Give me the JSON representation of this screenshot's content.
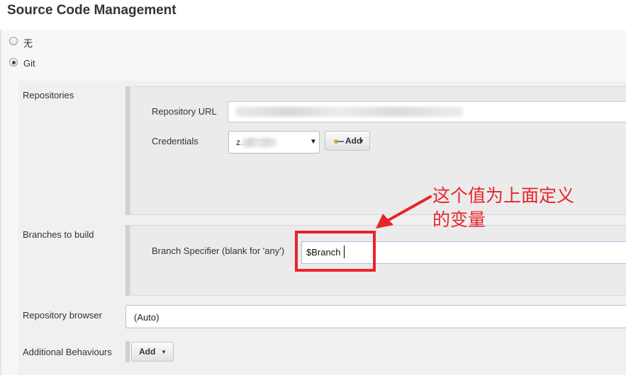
{
  "section": {
    "title": "Source Code Management"
  },
  "scm_options": [
    {
      "label": "无",
      "selected": false
    },
    {
      "label": "Git",
      "selected": true
    }
  ],
  "repositories": {
    "label": "Repositories",
    "url_label": "Repository URL",
    "credentials_label": "Credentials",
    "credentials_value": "z…/******",
    "add_button": "Add"
  },
  "branches": {
    "label": "Branches to build",
    "specifier_label": "Branch Specifier (blank for 'any')",
    "specifier_value": "$Branch"
  },
  "repository_browser": {
    "label": "Repository browser",
    "value": "(Auto)"
  },
  "additional_behaviours": {
    "label": "Additional Behaviours",
    "add_button": "Add"
  },
  "annotation": {
    "line1": "这个值为上面定义",
    "line2": "的变量",
    "color": "#e8242a"
  },
  "icons": {
    "credentials_add": "key-icon",
    "dropdown": "caret-down-icon"
  }
}
